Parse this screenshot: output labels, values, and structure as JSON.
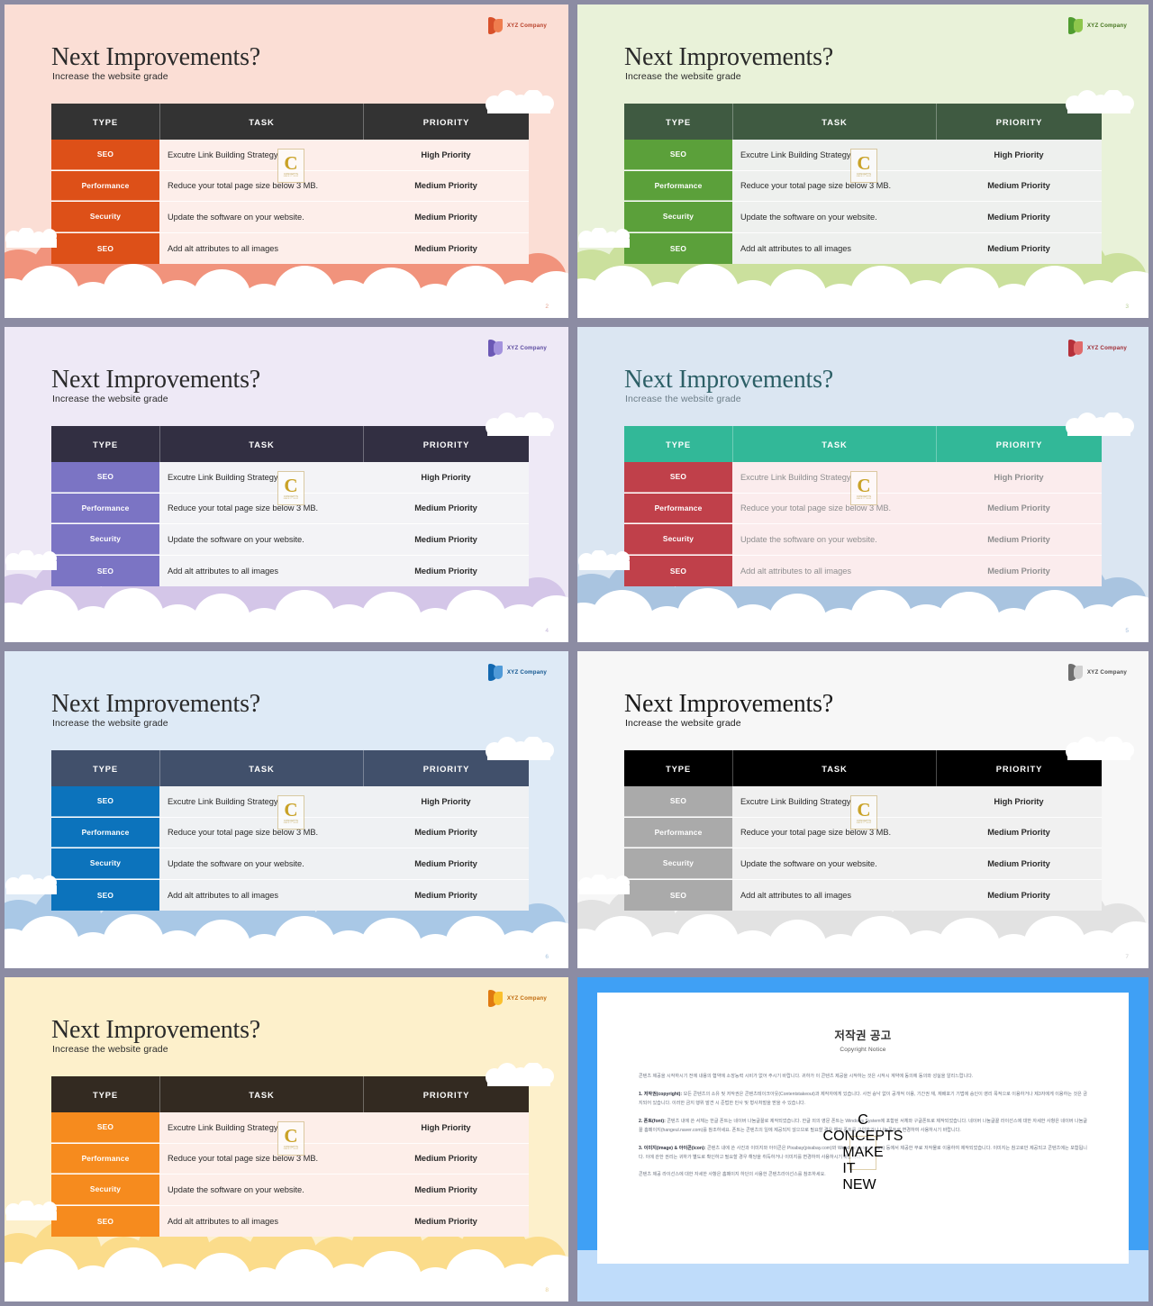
{
  "common": {
    "logo_text": "XYZ Company",
    "title": "Next Improvements?",
    "subtitle": "Increase the website grade",
    "headers": {
      "type": "TYPE",
      "task": "TASK",
      "priority": "PRIORITY"
    },
    "rows": [
      {
        "type": "SEO",
        "task": "Excutre Link Building Strategy",
        "priority": "High Priority"
      },
      {
        "type": "Performance",
        "task": "Reduce your total page size below 3 MB.",
        "priority": "Medium Priority"
      },
      {
        "type": "Security",
        "task": "Update the software on your website.",
        "priority": "Medium Priority"
      },
      {
        "type": "SEO",
        "task": "Add alt attributes to all images",
        "priority": "Medium Priority"
      }
    ],
    "watermark": {
      "letter": "C",
      "line1": "CONCEPTS",
      "line2": "MAKE IT NEW"
    }
  },
  "slides": [
    {
      "id": "slide-salmon",
      "page": "2",
      "bg": "#fbded5",
      "title_color": "#2a2a2a",
      "subtitle_color": "#2a2a2a",
      "header_bg": "#333333",
      "type_bg": "#dd5018",
      "body_bg": "#fdeeea",
      "task_color": "#2b2b2b",
      "pri_color": "#2b2b2b",
      "cloud_back": "#f1937c",
      "cloud_front": "#ffffff",
      "logo_c1": "#d8502a",
      "logo_c2": "#ef7d4e",
      "logo_text_color": "#b8412a",
      "page_color": "#e3a08e"
    },
    {
      "id": "slide-green",
      "page": "3",
      "bg": "#e9f2d9",
      "title_color": "#2a2a2a",
      "subtitle_color": "#2a2a2a",
      "header_bg": "#3f5a41",
      "type_bg": "#5ba03a",
      "body_bg": "#eef0ee",
      "task_color": "#2b2b2b",
      "pri_color": "#2b2b2b",
      "cloud_back": "#cbe09d",
      "cloud_front": "#ffffff",
      "logo_c1": "#4f9c30",
      "logo_c2": "#8ec64c",
      "logo_text_color": "#46751f",
      "page_color": "#b9cf96"
    },
    {
      "id": "slide-purple",
      "page": "4",
      "bg": "#eee9f6",
      "title_color": "#2a2a2a",
      "subtitle_color": "#2a2a2a",
      "header_bg": "#322f42",
      "type_bg": "#7b74c4",
      "body_bg": "#f3f3f6",
      "task_color": "#2b2b2b",
      "pri_color": "#2b2b2b",
      "cloud_back": "#d4c6e8",
      "cloud_front": "#ffffff",
      "logo_c1": "#6b58b5",
      "logo_c2": "#a392dd",
      "logo_text_color": "#5b4aa0",
      "page_color": "#c3b6da"
    },
    {
      "id": "slide-teal",
      "page": "5",
      "bg": "#dbe6f2",
      "title_color": "#2c5f66",
      "subtitle_color": "#6d7e88",
      "header_bg": "#32b898",
      "type_bg": "#c0404a",
      "body_bg": "#fbeced",
      "task_color": "#8f8f90",
      "pri_color": "#8f8f90",
      "cloud_back": "#a9c4e0",
      "cloud_front": "#ffffff",
      "logo_c1": "#b5303a",
      "logo_c2": "#e06a6a",
      "logo_text_color": "#a02c34",
      "page_color": "#9fbada"
    },
    {
      "id": "slide-blue",
      "page": "6",
      "bg": "#deeaf6",
      "title_color": "#2a2a2a",
      "subtitle_color": "#2a2a2a",
      "header_bg": "#41506b",
      "type_bg": "#0c73bc",
      "body_bg": "#eff1f3",
      "task_color": "#2b2b2b",
      "pri_color": "#2b2b2b",
      "cloud_back": "#a9c8e6",
      "cloud_front": "#ffffff",
      "logo_c1": "#1268b0",
      "logo_c2": "#4f9ad8",
      "logo_text_color": "#10558f",
      "page_color": "#a6c2de"
    },
    {
      "id": "slide-gray",
      "page": "7",
      "bg": "#f7f7f7",
      "title_color": "#1a1a1a",
      "subtitle_color": "#1a1a1a",
      "header_bg": "#000000",
      "type_bg": "#aaaaaa",
      "body_bg": "#f0f0f0",
      "task_color": "#2b2b2b",
      "pri_color": "#2b2b2b",
      "cloud_back": "#e2e2e2",
      "cloud_front": "#ffffff",
      "logo_c1": "#6e6e6e",
      "logo_c2": "#cfcfcf",
      "logo_text_color": "#4a4a4a",
      "page_color": "#cccccc"
    },
    {
      "id": "slide-orange",
      "page": "8",
      "bg": "#fdf0cb",
      "title_color": "#2a2a2a",
      "subtitle_color": "#2a2a2a",
      "header_bg": "#332a21",
      "type_bg": "#f68b1e",
      "body_bg": "#fdeee9",
      "task_color": "#2b2b2b",
      "pri_color": "#2b2b2b",
      "cloud_back": "#fbdc8b",
      "cloud_front": "#ffffff",
      "logo_c1": "#e07a10",
      "logo_c2": "#fbc02d",
      "logo_text_color": "#c0690c",
      "page_color": "#e9cf92"
    }
  ],
  "copyright": {
    "title": "저작권 공고",
    "subtitle": "Copyright Notice",
    "intro": "콘텐츠 제공을 시작하시기 전에 내용의 협약에 소장능력 시비가 없어 주시기 바랍니다. 귀하가 이 콘텐츠 제공을 시작하는 것은 시작시 계약에 동의에 동의와 성실을 알리느랍니다.",
    "section1_label": "1. 저작권(copyright):",
    "section1_text": "모든 콘텐츠의 소유 및 저작권은 콘텐츠테이크아웃(Contentstakeout)과 제작자에게 있습니다. 사전 승낙 없이 공개적 이용, 기간권 재, 재배포기 기법에 승인이 영리 목적으로 이용하거나 제3자에게 이용하는 것은 금지되어 있습니다. 이러한 금지 행위 발견 시 준법한 민사 및 형사처벌을 받을 수 있습니다.",
    "section2_label": "2. 폰트(font):",
    "section2_text": "콘텐츠 내에 쓴 서체는 한글 폰트는 네이버 나눔글꼴로 제작되었습니다. 한글 외의 영문 폰트는 Windows System에 포함된 서체와 구글폰트로 제작되었습니다. 네이버 나눔글꼴 라이선스에 대한 자세한 사항은 네이버 나눔글꼴 홈페이지(hangeul.naver.com)를 참조하세요. 폰트는 콘텐츠의 일에 제공되지 않으므로 필요할 경우 해당 폰트를 구입하거나 나눔폰트로 변경하여 사용하시기 바랍니다.",
    "section3_label": "3. 이미지(image) & 아이콘(icon):",
    "section3_text": "콘텐츠 내에 쓴 사진과 이미지와 아이콘은 Pixabay(pixabay.com)와 Webdyls(webdyls.com) 등에서 제공한 무료 저작물로 이용하여 제작되었습니다. 이미지는 참고로만 제공되고 콘텐츠에는 포함됩니다. 이에 관한 권리는 귀하가 별도로 확인하고 필요할 경우 해당을 취득하거나 이미지를 변경하여 사용하시기 바랍니다.",
    "footer": "콘텐츠 제공 라이선스에 대한 자세한 사항은 홈페이지 하단의 사용한 콘텐츠라이선스를 참조하세요."
  }
}
